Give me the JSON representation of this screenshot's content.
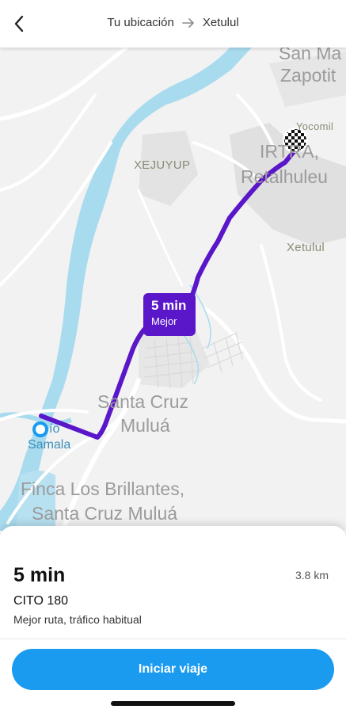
{
  "header": {
    "origin": "Tu ubicación",
    "destination": "Xetulul",
    "back_icon": "chevron-left-icon",
    "arrow_icon": "arrow-right-icon"
  },
  "map": {
    "labels": {
      "san_ma": "San Ma",
      "zapotit": "Zapotit",
      "yocomil": "Yocomil",
      "irtra": "IRTRA,",
      "retalhuleu": "Retalhuleu",
      "xejuyup": "XEJUYUP",
      "xetulul": "Xetulul",
      "santa_cruz": "Santa Cruz",
      "mulua": "Muluá",
      "rio": "ío",
      "samala": "Samala",
      "finca_1": "Finca Los Brillantes,",
      "finca_2": "Santa Cruz Muluá"
    },
    "eta_badge": {
      "time": "5 min",
      "label": "Mejor"
    },
    "colors": {
      "route": "#5a16c9",
      "water": "#a9dbef",
      "badge": "#5a16c9"
    }
  },
  "sheet": {
    "eta": "5 min",
    "distance": "3.8 km",
    "road": "CITO 180",
    "description": "Mejor ruta, tráfico habitual",
    "start_button": "Iniciar viaje",
    "button_color": "#1a9bf0"
  }
}
